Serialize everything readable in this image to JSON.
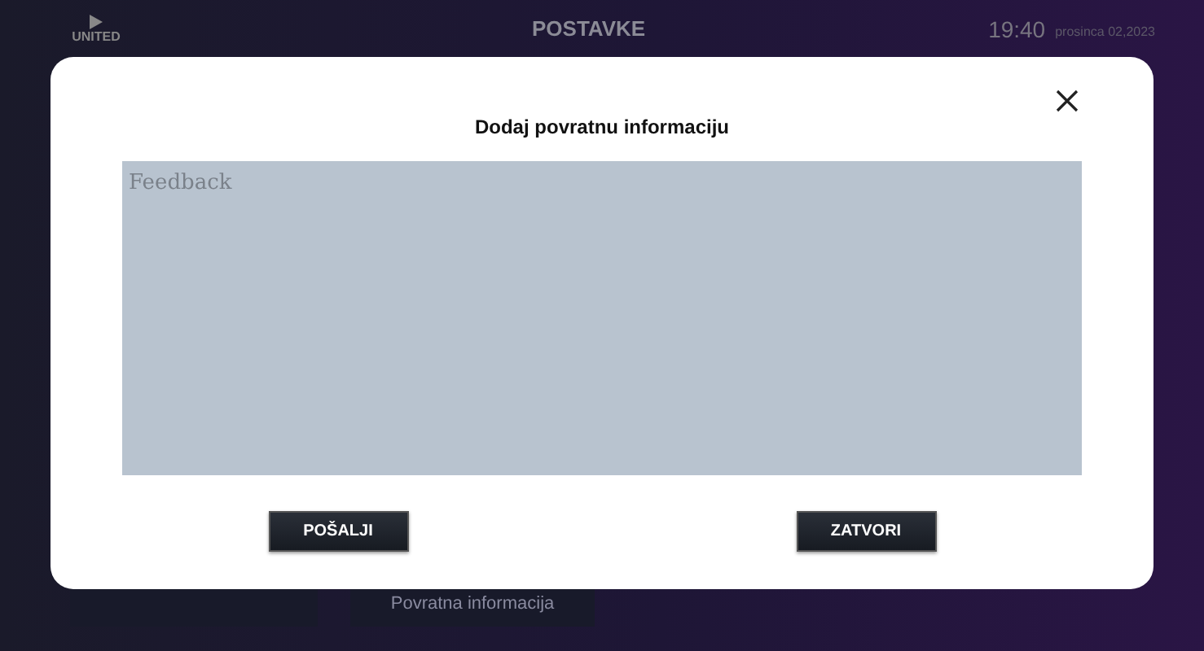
{
  "header": {
    "logo": "UNITED",
    "title": "POSTAVKE",
    "time": "19:40",
    "date": "prosinca 02,2023"
  },
  "menu_tiles": [
    {
      "label": "Povratna informacija"
    }
  ],
  "dialog": {
    "title": "Dodaj povratnu informaciju",
    "feedback": {
      "placeholder": "Feedback"
    },
    "buttons": [
      "POŠALJI",
      "ZATVORI"
    ]
  }
}
